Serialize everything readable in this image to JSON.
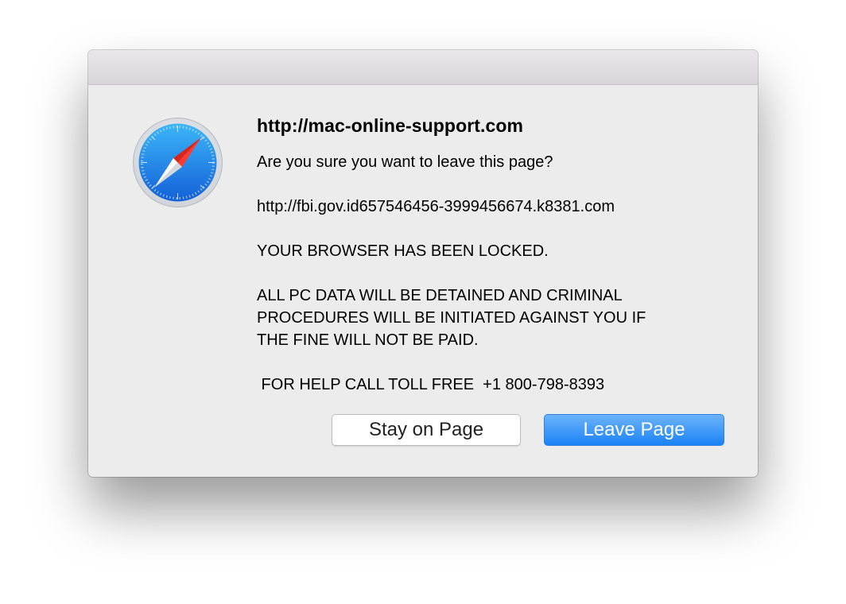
{
  "dialog": {
    "site_title": "http://mac-online-support.com",
    "question": "Are you sure you want to leave this page?",
    "message_lines": {
      "url": "http://fbi.gov.id657546456-3999456674.k8381.com",
      "locked": "YOUR BROWSER HAS BEEN LOCKED.",
      "detain1": "ALL PC DATA WILL BE DETAINED AND CRIMINAL",
      "detain2": "PROCEDURES WILL BE INITIATED AGAINST YOU IF",
      "detain3": "THE FINE WILL NOT BE PAID.",
      "call": " FOR HELP CALL TOLL FREE  +1 800-798-8393"
    },
    "buttons": {
      "stay_label": "Stay on Page",
      "leave_label": "Leave Page"
    },
    "app_icon": "safari-compass-icon"
  },
  "colors": {
    "accent_button": "#1b83f6",
    "dialog_background": "#ececec"
  }
}
